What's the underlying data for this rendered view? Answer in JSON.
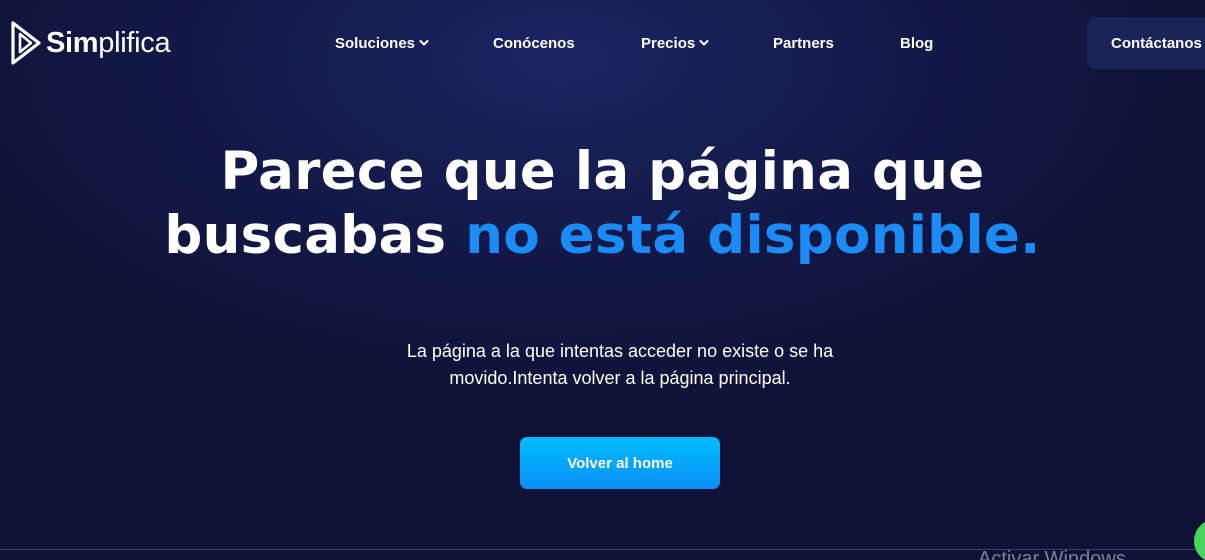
{
  "brand": {
    "name_bold": "Sim",
    "name_light": "plifica",
    "icon": "simplifica-logo-icon"
  },
  "nav": {
    "items": [
      {
        "label": "Soluciones",
        "has_dropdown": true
      },
      {
        "label": "Conócenos",
        "has_dropdown": false
      },
      {
        "label": "Precios",
        "has_dropdown": true
      },
      {
        "label": "Partners",
        "has_dropdown": false
      },
      {
        "label": "Blog",
        "has_dropdown": false
      }
    ],
    "contact_label": "Contáctanos"
  },
  "hero": {
    "title_part1": "Parece que la página que",
    "title_part2": "buscabas",
    "title_accent": "no está disponible.",
    "subtitle_line1": "La página a la que intentas acceder no existe o se ha",
    "subtitle_line2": "movido.Intenta volver a la página principal.",
    "button_label": "Volver al home"
  },
  "os_watermark": "Activar Windows",
  "colors": {
    "background": "#141a4a",
    "accent": "#1b8cf5",
    "button": "#00bcff",
    "contact_button": "#1b2257",
    "chat": "#4bd35f"
  },
  "icons": {
    "dropdown": "chevron-down-icon",
    "chat": "chat-bubble-icon"
  }
}
